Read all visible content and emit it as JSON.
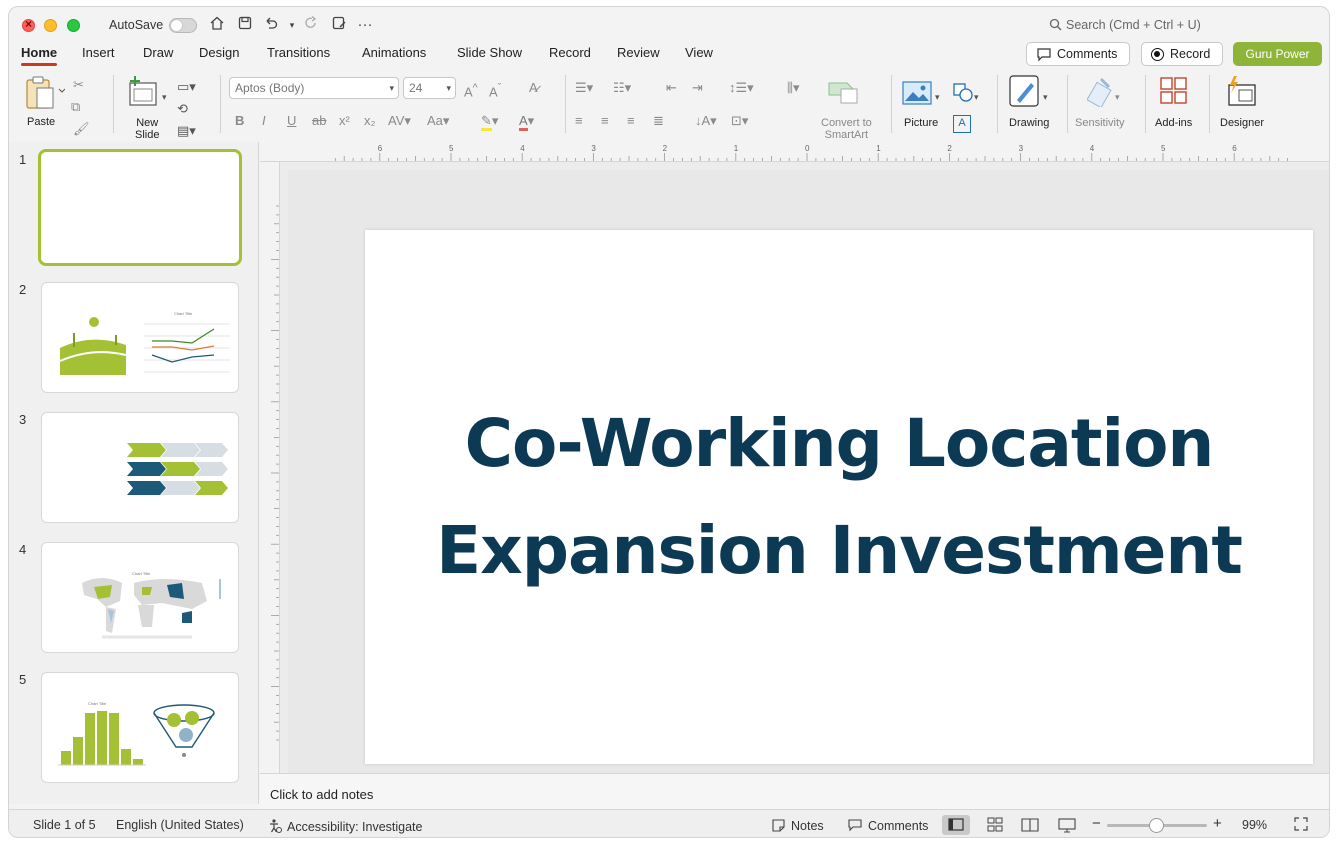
{
  "titlebar": {
    "autosave_label": "AutoSave",
    "search_placeholder": "Search (Cmd + Ctrl + U)"
  },
  "tabs": [
    {
      "label": "Home",
      "active": true
    },
    {
      "label": "Insert"
    },
    {
      "label": "Draw"
    },
    {
      "label": "Design"
    },
    {
      "label": "Transitions"
    },
    {
      "label": "Animations"
    },
    {
      "label": "Slide Show"
    },
    {
      "label": "Record"
    },
    {
      "label": "Review"
    },
    {
      "label": "View"
    }
  ],
  "header_buttons": {
    "comments": "Comments",
    "record": "Record",
    "guru": "Guru Power",
    "guru_color": "#8fb43a"
  },
  "ribbon": {
    "paste": "Paste",
    "new_slide_line1": "New",
    "new_slide_line2": "Slide",
    "font_name": "Aptos (Body)",
    "font_size": "24",
    "convert_line1": "Convert to",
    "convert_line2": "SmartArt",
    "picture": "Picture",
    "drawing": "Drawing",
    "sensitivity": "Sensitivity",
    "addins": "Add-ins",
    "designer": "Designer"
  },
  "thumbnails": [
    {
      "number": "1",
      "selected": true
    },
    {
      "number": "2"
    },
    {
      "number": "3"
    },
    {
      "number": "4"
    },
    {
      "number": "5"
    }
  ],
  "thumb_text": {
    "chart_title": "Chart Title"
  },
  "slide": {
    "title_line1": "Co-Working Location",
    "title_line2": "Expansion Investment",
    "title_color": "#0c3a55"
  },
  "notes": {
    "placeholder": "Click to add notes"
  },
  "status": {
    "slide_info": "Slide 1 of 5",
    "language": "English (United States)",
    "accessibility": "Accessibility: Investigate",
    "notes": "Notes",
    "comments": "Comments",
    "zoom": "99%"
  },
  "colors": {
    "accent_tab": "#c43e1c",
    "selected_thumb": "#a4c034",
    "green": "#a4c034",
    "navy": "#1d5a7a"
  }
}
